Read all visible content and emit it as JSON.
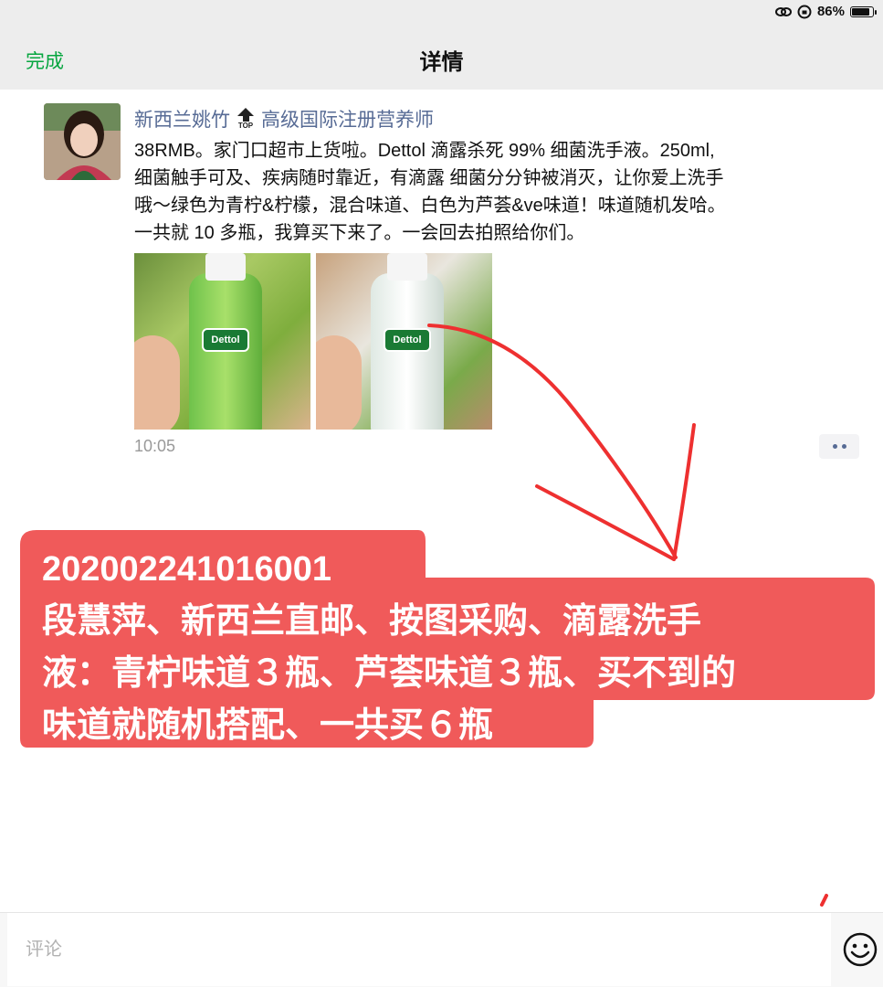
{
  "status_bar": {
    "battery_percent": "86%",
    "battery_level": 0.86,
    "icons": [
      "link-icon",
      "orientation-lock-icon",
      "battery-icon"
    ]
  },
  "nav": {
    "done_label": "完成",
    "title": "详情",
    "accent_color": "#07a640"
  },
  "post": {
    "author": "新西兰姚竹",
    "badge_text": "TOP",
    "author_title": "高级国际注册营养师",
    "text_lines": [
      "38RMB。家门口超市上货啦。Dettol 滴露杀死 99% 细菌洗手液。250ml,",
      "细菌触手可及、疾病随时靠近，有滴露 细菌分分钟被消灭，让你爱上洗手",
      "哦～绿色为青柠&柠檬，混合味道、白色为芦荟&ve味道！味道随机发哈。",
      "一共就 10 多瓶，我算买下来了。一会回去拍照给你们。"
    ],
    "photos": [
      {
        "brand": "Dettol"
      },
      {
        "brand": "Dettol"
      }
    ],
    "time": "10:05",
    "link_color": "#576b95"
  },
  "annotation": {
    "lines": [
      "202002241016001",
      " 段慧萍、新西兰直邮、按图采购、滴露洗手",
      "液：青柠味道３瓶、芦荟味道３瓶、买不到的",
      "味道就随机搭配、一共买６瓶"
    ],
    "highlight_color": "#f05a5a",
    "arrow_color": "#ee3030"
  },
  "comment": {
    "placeholder": "评论"
  }
}
